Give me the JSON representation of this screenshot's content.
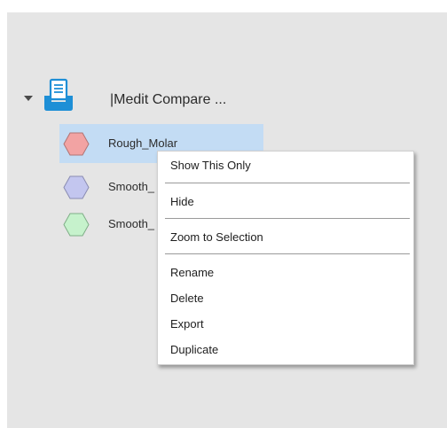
{
  "tree": {
    "group": {
      "label": "|Medit Compare ...",
      "icon": "document-tray-icon",
      "expanded": true
    },
    "items": [
      {
        "label": "Rough_Molar",
        "color": "#f2a3a3",
        "stroke": "#b07474",
        "icon": "hexagon-icon",
        "selected": true
      },
      {
        "label": "Smooth_",
        "color": "#c3c6ef",
        "stroke": "#8a8cb2",
        "icon": "hexagon-icon",
        "selected": false
      },
      {
        "label": "Smooth_",
        "color": "#c6f2cc",
        "stroke": "#7fae87",
        "icon": "hexagon-icon",
        "selected": false
      }
    ]
  },
  "context_menu": {
    "show_this_only": "Show This Only",
    "hide": "Hide",
    "zoom_to_selection": "Zoom to Selection",
    "rename": "Rename",
    "delete": "Delete",
    "export": "Export",
    "duplicate": "Duplicate"
  },
  "colors": {
    "panel_bg": "#e5e5e5",
    "selection_bg": "#c3dcf4",
    "icon_blue": "#1e8fd6"
  }
}
